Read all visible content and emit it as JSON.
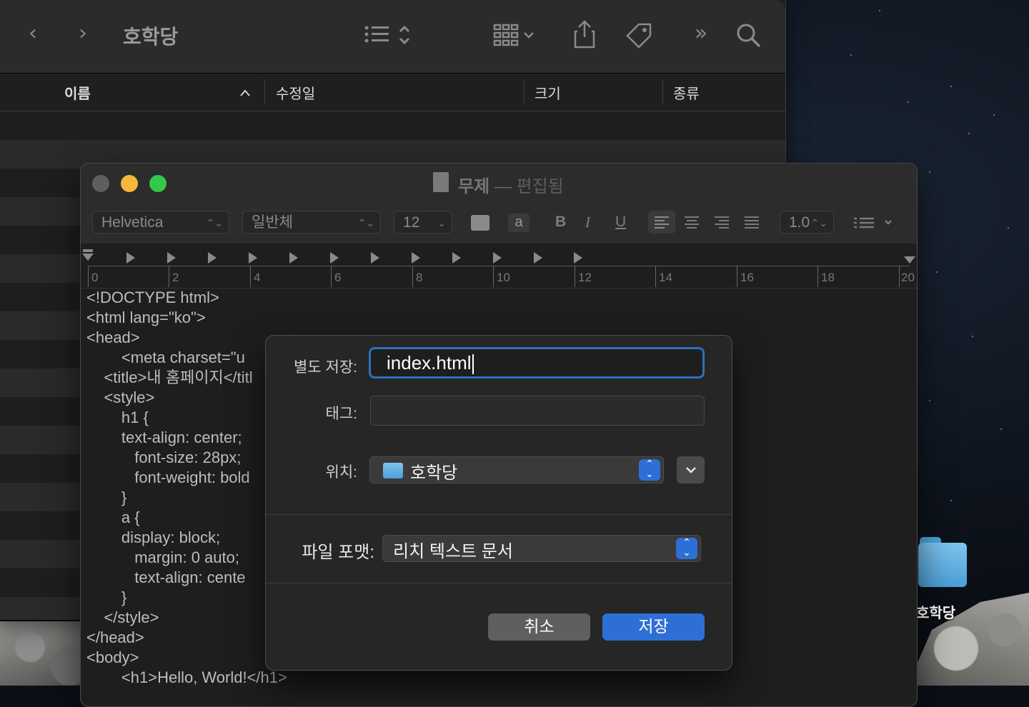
{
  "finder": {
    "title": "호학당",
    "columns": [
      "이름",
      "수정일",
      "크기",
      "종류"
    ]
  },
  "desktop": {
    "folder_label": "호학당"
  },
  "textedit": {
    "doc_title": "무제",
    "separator": "—",
    "edited_label": "편집됨",
    "font_family": "Helvetica",
    "font_style": "일반체",
    "font_size": "12",
    "bold_label": "B",
    "italic_label": "I",
    "underline_label": "U",
    "strike_label": "a",
    "line_spacing": "1.0",
    "ruler_numbers": [
      "0",
      "2",
      "4",
      "6",
      "8",
      "10",
      "12",
      "14",
      "16",
      "18",
      "20"
    ],
    "code_lines": [
      "<!DOCTYPE html>",
      "<html lang=\"ko\">",
      "<head>",
      "        <meta charset=\"u",
      "    <title>내 홈페이지</titl",
      "    <style>",
      "        h1 {",
      "        text-align: center;",
      "           font-size: 28px;",
      "           font-weight: bold",
      "        }",
      "        a {",
      "        display: block;",
      "           margin: 0 auto;",
      "           text-align: cente",
      "        }",
      "    </style>",
      "</head>",
      "<body>",
      "        <h1>Hello, World!</h1>"
    ]
  },
  "save_sheet": {
    "save_as_label": "별도 저장:",
    "save_as_value": "index.html",
    "tags_label": "태그:",
    "location_label": "위치:",
    "location_value": "호학당",
    "format_label": "파일 포맷:",
    "format_value": "리치 텍스트 문서",
    "cancel_label": "취소",
    "save_label": "저장"
  },
  "colors": {
    "accent": "#2e6fd6",
    "focus_ring": "#2d6fc0",
    "traffic_close": "#5f5f5f",
    "traffic_minimize": "#f5b83d",
    "traffic_zoom": "#34c749"
  }
}
